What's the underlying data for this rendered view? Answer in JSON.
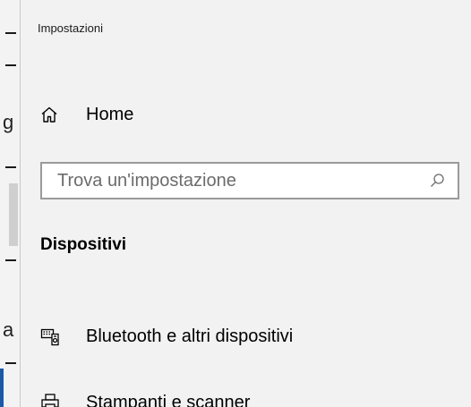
{
  "app": {
    "title": "Impostazioni"
  },
  "nav": {
    "home_label": "Home",
    "home_icon": "home-icon"
  },
  "search": {
    "value": "",
    "placeholder": "Trova un'impostazione",
    "icon": "search-icon"
  },
  "section": {
    "heading": "Dispositivi",
    "items": [
      {
        "label": "Bluetooth e altri dispositivi",
        "icon": "devices-icon"
      },
      {
        "label": "Stampanti e scanner",
        "icon": "printer-icon"
      }
    ]
  },
  "background_window": {
    "glyphs": [
      "g",
      "a"
    ]
  },
  "colors": {
    "panel_background": "#f2f2f2",
    "search_border": "#9a9a9a",
    "accent": "#1a5aa8"
  }
}
